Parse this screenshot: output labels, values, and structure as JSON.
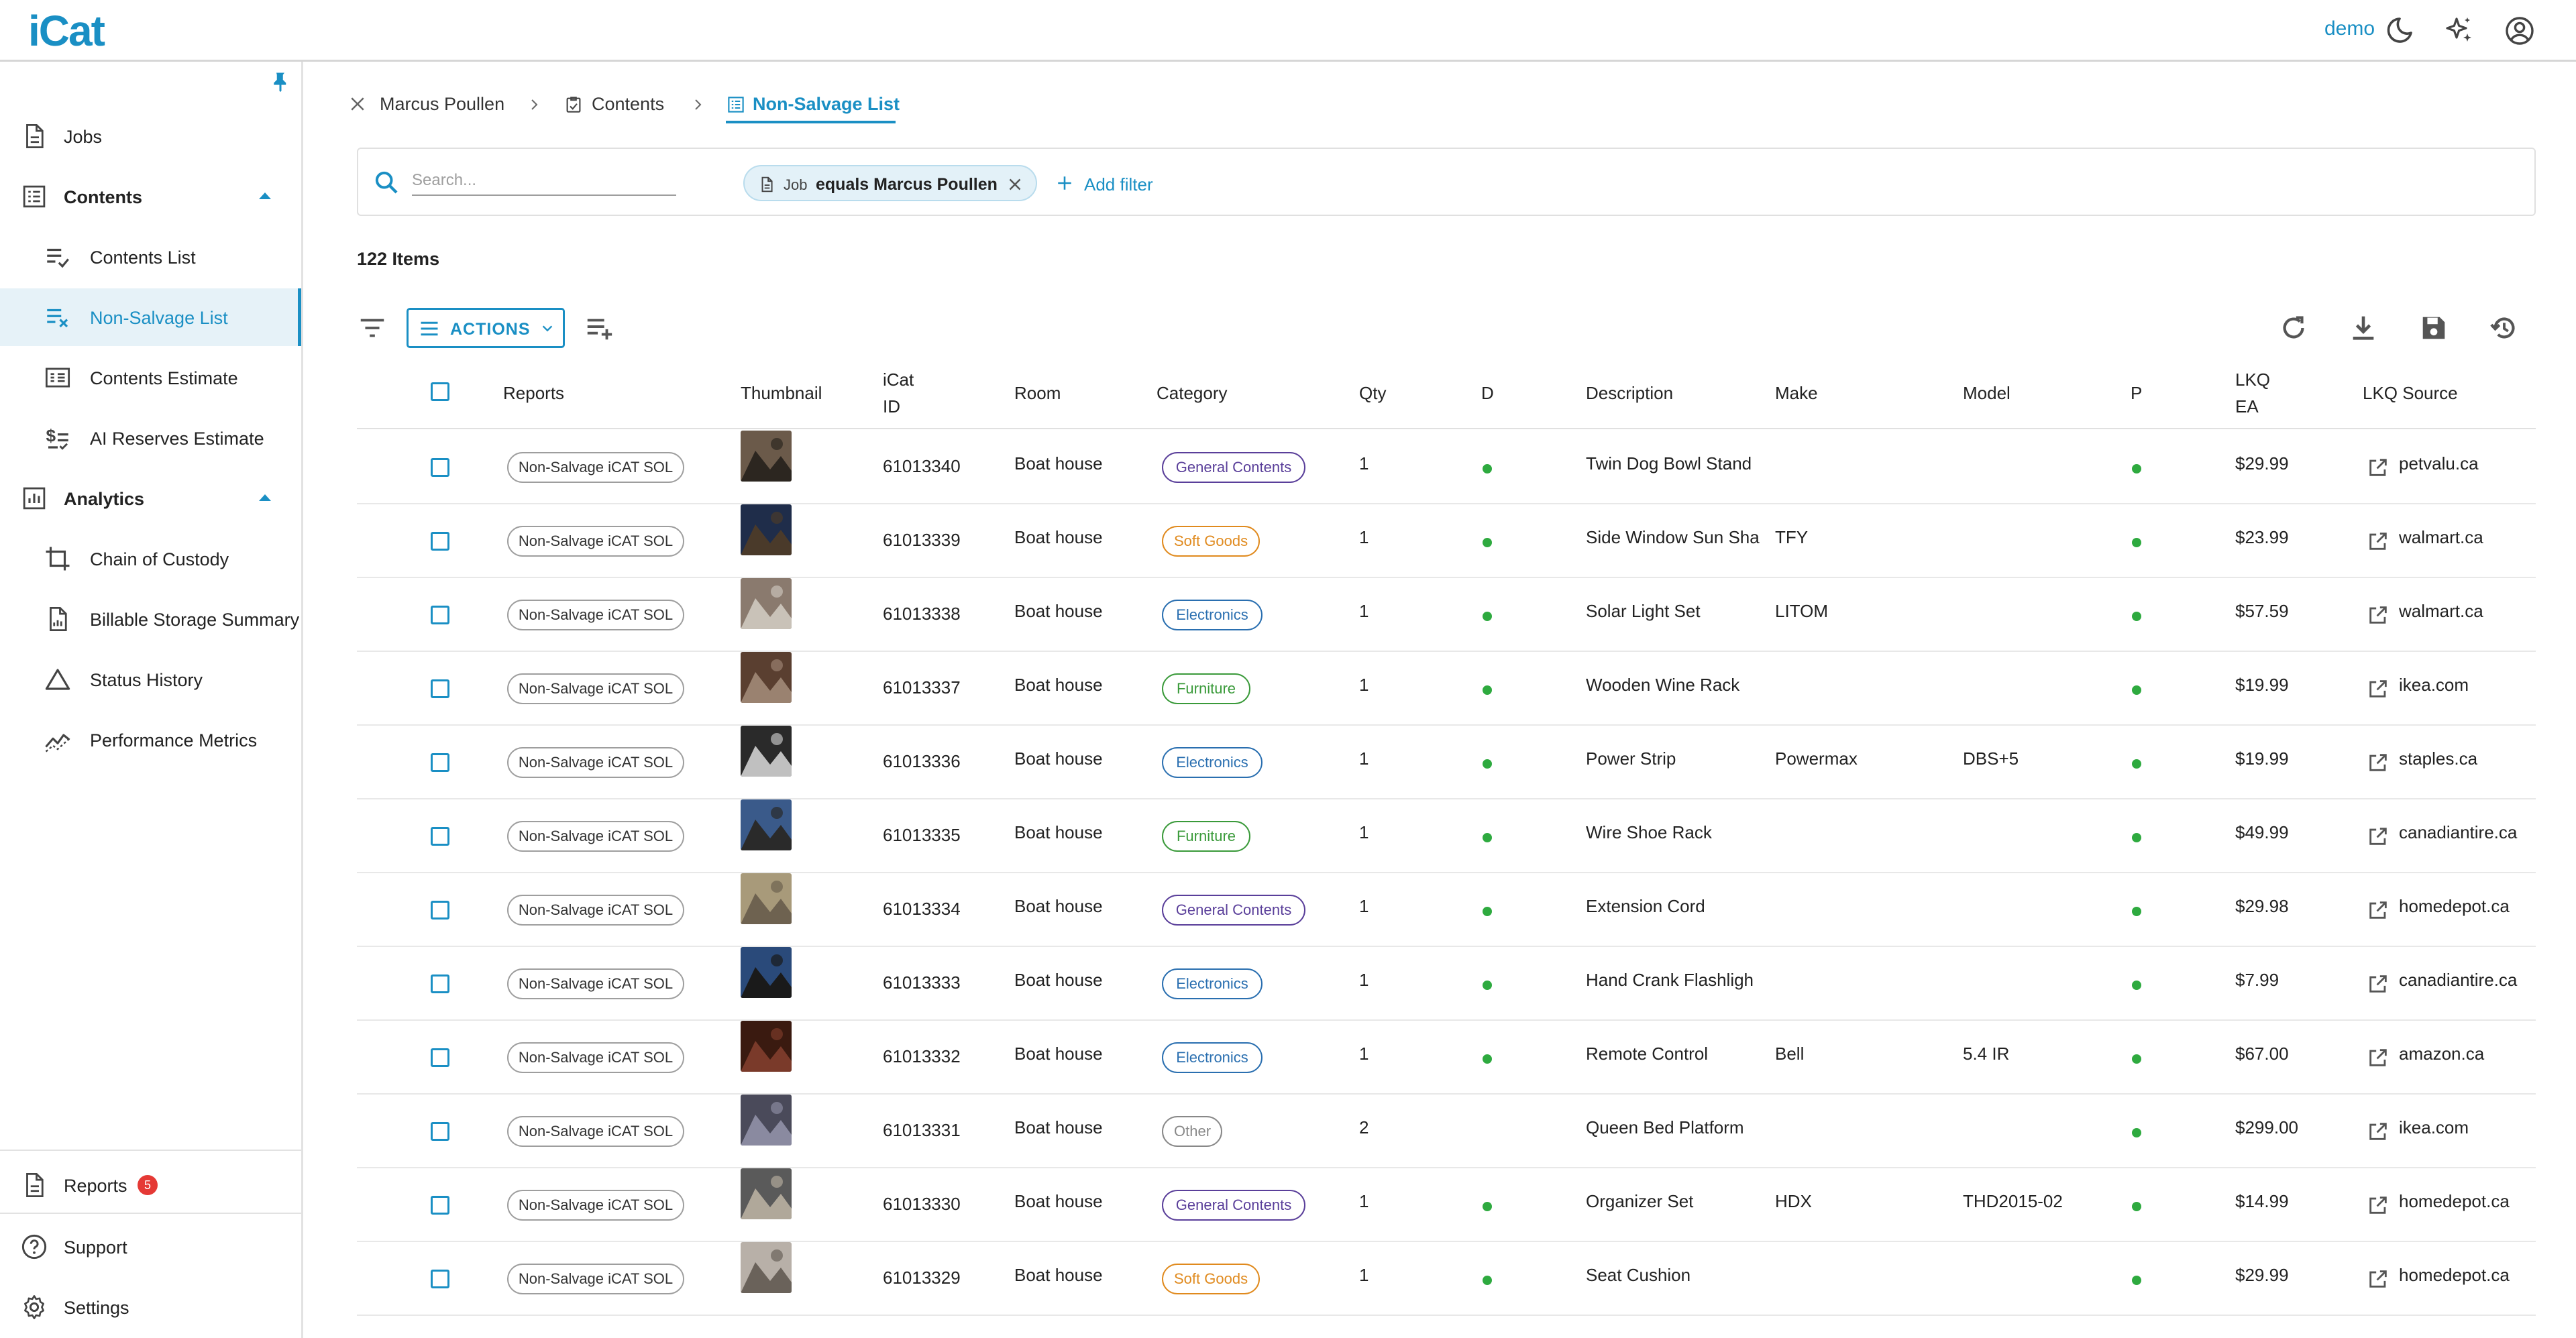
{
  "app": {
    "logo": "iCat",
    "user": "demo"
  },
  "sidebar": {
    "jobs": "Jobs",
    "contents": "Contents",
    "contents_list": "Contents List",
    "non_salvage_list": "Non-Salvage List",
    "contents_estimate": "Contents Estimate",
    "ai_reserves_estimate": "AI Reserves Estimate",
    "analytics": "Analytics",
    "chain_of_custody": "Chain of Custody",
    "billable_storage_summary": "Billable Storage Summary",
    "status_history": "Status History",
    "performance_metrics": "Performance Metrics",
    "reports": "Reports",
    "reports_badge": "5",
    "support": "Support",
    "settings": "Settings"
  },
  "breadcrumb": {
    "job": "Marcus Poullen",
    "contents": "Contents",
    "current": "Non-Salvage List"
  },
  "filter": {
    "search_placeholder": "Search...",
    "chip_field": "Job",
    "chip_value": "equals Marcus Poullen",
    "add_filter": "Add filter"
  },
  "items_count": "122 Items",
  "toolbar": {
    "actions_label": "ACTIONS"
  },
  "table": {
    "headers": {
      "reports": "Reports",
      "thumbnail": "Thumbnail",
      "icat_id_1": "iCat",
      "icat_id_2": "ID",
      "room": "Room",
      "category": "Category",
      "qty": "Qty",
      "d": "D",
      "description": "Description",
      "make": "Make",
      "model": "Model",
      "p": "P",
      "lkq_ea_1": "LKQ",
      "lkq_ea_2": "EA",
      "lkq_source": "LKQ Source"
    },
    "rows": [
      {
        "report": "Non-Salvage iCAT SOL",
        "id": "61013340",
        "room": "Boat house",
        "category": "General Contents",
        "qty": "1",
        "description": "Twin Dog Bowl Stand",
        "make": "",
        "model": "",
        "lkq_ea": "$29.99",
        "source": "petvalu.ca"
      },
      {
        "report": "Non-Salvage iCAT SOL",
        "id": "61013339",
        "room": "Boat house",
        "category": "Soft Goods",
        "qty": "1",
        "description": "Side Window Sun Sha",
        "make": "TFY",
        "model": "",
        "lkq_ea": "$23.99",
        "source": "walmart.ca"
      },
      {
        "report": "Non-Salvage iCAT SOL",
        "id": "61013338",
        "room": "Boat house",
        "category": "Electronics",
        "qty": "1",
        "description": "Solar Light Set",
        "make": "LITOM",
        "model": "",
        "lkq_ea": "$57.59",
        "source": "walmart.ca"
      },
      {
        "report": "Non-Salvage iCAT SOL",
        "id": "61013337",
        "room": "Boat house",
        "category": "Furniture",
        "qty": "1",
        "description": "Wooden Wine Rack",
        "make": "",
        "model": "",
        "lkq_ea": "$19.99",
        "source": "ikea.com"
      },
      {
        "report": "Non-Salvage iCAT SOL",
        "id": "61013336",
        "room": "Boat house",
        "category": "Electronics",
        "qty": "1",
        "description": "Power Strip",
        "make": "Powermax",
        "model": "DBS+5",
        "lkq_ea": "$19.99",
        "source": "staples.ca"
      },
      {
        "report": "Non-Salvage iCAT SOL",
        "id": "61013335",
        "room": "Boat house",
        "category": "Furniture",
        "qty": "1",
        "description": "Wire Shoe Rack",
        "make": "",
        "model": "",
        "lkq_ea": "$49.99",
        "source": "canadiantire.ca"
      },
      {
        "report": "Non-Salvage iCAT SOL",
        "id": "61013334",
        "room": "Boat house",
        "category": "General Contents",
        "qty": "1",
        "description": "Extension Cord",
        "make": "",
        "model": "",
        "lkq_ea": "$29.98",
        "source": "homedepot.ca"
      },
      {
        "report": "Non-Salvage iCAT SOL",
        "id": "61013333",
        "room": "Boat house",
        "category": "Electronics",
        "qty": "1",
        "description": "Hand Crank Flashligh",
        "make": "",
        "model": "",
        "lkq_ea": "$7.99",
        "source": "canadiantire.ca"
      },
      {
        "report": "Non-Salvage iCAT SOL",
        "id": "61013332",
        "room": "Boat house",
        "category": "Electronics",
        "qty": "1",
        "description": "Remote Control",
        "make": "Bell",
        "model": "5.4 IR",
        "lkq_ea": "$67.00",
        "source": "amazon.ca"
      },
      {
        "report": "Non-Salvage iCAT SOL",
        "id": "61013331",
        "room": "Boat house",
        "category": "Other",
        "qty": "2",
        "description": "Queen Bed Platform",
        "make": "",
        "model": "",
        "lkq_ea": "$299.00",
        "source": "ikea.com"
      },
      {
        "report": "Non-Salvage iCAT SOL",
        "id": "61013330",
        "room": "Boat house",
        "category": "General Contents",
        "qty": "1",
        "description": "Organizer Set",
        "make": "HDX",
        "model": "THD2015-02",
        "lkq_ea": "$14.99",
        "source": "homedepot.ca"
      },
      {
        "report": "Non-Salvage iCAT SOL",
        "id": "61013329",
        "room": "Boat house",
        "category": "Soft Goods",
        "qty": "1",
        "description": "Seat Cushion",
        "make": "",
        "model": "",
        "lkq_ea": "$29.99",
        "source": "homedepot.ca"
      }
    ]
  },
  "colors": {
    "accent": "#1a8fc4",
    "general_contents": "#5a3f9a",
    "soft_goods": "#e08a1e",
    "electronics": "#2a6fb0",
    "furniture": "#3a9a3a",
    "other": "#888888",
    "status_dot": "#2eaa3f"
  },
  "icons": {
    "top": [
      "moon-icon",
      "sparkle-icon",
      "account-icon"
    ],
    "toolbar": [
      "filter-icon",
      "add-column-icon",
      "refresh-icon",
      "download-icon",
      "save-icon",
      "restore-icon"
    ]
  }
}
